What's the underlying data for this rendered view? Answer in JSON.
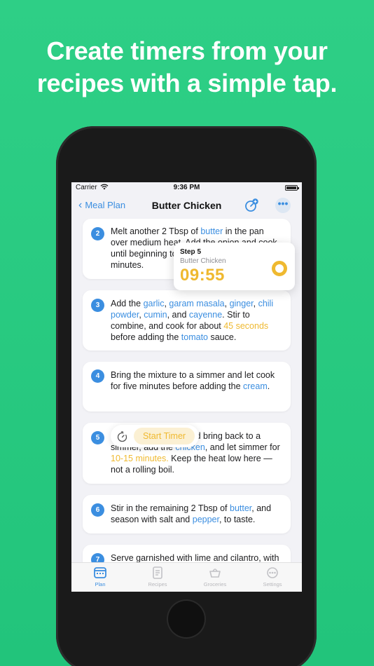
{
  "promo": {
    "headline_line1": "Create timers from your",
    "headline_line2": "recipes with a simple tap."
  },
  "status_bar": {
    "carrier": "Carrier",
    "time": "9:36 PM"
  },
  "nav": {
    "back_label": "Meal Plan",
    "title": "Butter Chicken",
    "timer_icon": "add-timer-icon",
    "more_icon": "ellipsis-icon"
  },
  "colors": {
    "accent": "#3b8ee0",
    "timer": "#efb930",
    "background": "#24c87d"
  },
  "steps": [
    {
      "number": "2",
      "segments": [
        {
          "t": "Melt another 2 Tbsp of "
        },
        {
          "t": "butter",
          "k": "ing"
        },
        {
          "t": " in the pan over medium heat. Add the onion and cook until beginning to brown, about three minutes."
        }
      ]
    },
    {
      "number": "3",
      "segments": [
        {
          "t": "Add the "
        },
        {
          "t": "garlic",
          "k": "ing"
        },
        {
          "t": ", "
        },
        {
          "t": "garam masala",
          "k": "ing"
        },
        {
          "t": ", "
        },
        {
          "t": "ginger",
          "k": "ing"
        },
        {
          "t": ", "
        },
        {
          "t": "chili powder",
          "k": "ing"
        },
        {
          "t": ", "
        },
        {
          "t": "cumin",
          "k": "ing"
        },
        {
          "t": ", and "
        },
        {
          "t": "cayenne",
          "k": "ing"
        },
        {
          "t": ". Stir to combine, and cook for about "
        },
        {
          "t": "45 seconds",
          "k": "dur"
        },
        {
          "t": " before adding the "
        },
        {
          "t": "tomato",
          "k": "ing"
        },
        {
          "t": " sauce."
        }
      ]
    },
    {
      "number": "4",
      "segments": [
        {
          "t": "Bring the mixture to a simmer and let cook for five minutes before adding the "
        },
        {
          "t": "cream",
          "k": "ing"
        },
        {
          "t": "."
        }
      ]
    },
    {
      "number": "5",
      "segments": [
        {
          "t": "Return the chicken and bring back to a simmer, add the "
        },
        {
          "t": "chicken",
          "k": "ing"
        },
        {
          "t": ", and let simmer for "
        },
        {
          "t": "10-15 minutes.",
          "k": "dur"
        },
        {
          "t": " Keep the heat low here — not a rolling boil."
        }
      ]
    },
    {
      "number": "6",
      "segments": [
        {
          "t": "Stir in the remaining 2 Tbsp of "
        },
        {
          "t": "butter",
          "k": "ing"
        },
        {
          "t": ", and season with salt and "
        },
        {
          "t": "pepper",
          "k": "ing"
        },
        {
          "t": ", to taste."
        }
      ]
    },
    {
      "number": "7",
      "segments": [
        {
          "t": "Serve garnished with lime and cilantro, with rice."
        }
      ]
    }
  ],
  "timer_popup": {
    "step_label": "Step 5",
    "recipe": "Butter Chicken",
    "remaining": "09:55",
    "progress": 0.99
  },
  "start_timer": {
    "label": "Start Timer",
    "icon": "stopwatch-icon"
  },
  "tabs": [
    {
      "label": "Plan",
      "icon": "calendar-icon",
      "active": true
    },
    {
      "label": "Recipes",
      "icon": "document-icon",
      "active": false
    },
    {
      "label": "Groceries",
      "icon": "basket-icon",
      "active": false
    },
    {
      "label": "Settings",
      "icon": "gear-icon",
      "active": false
    }
  ]
}
